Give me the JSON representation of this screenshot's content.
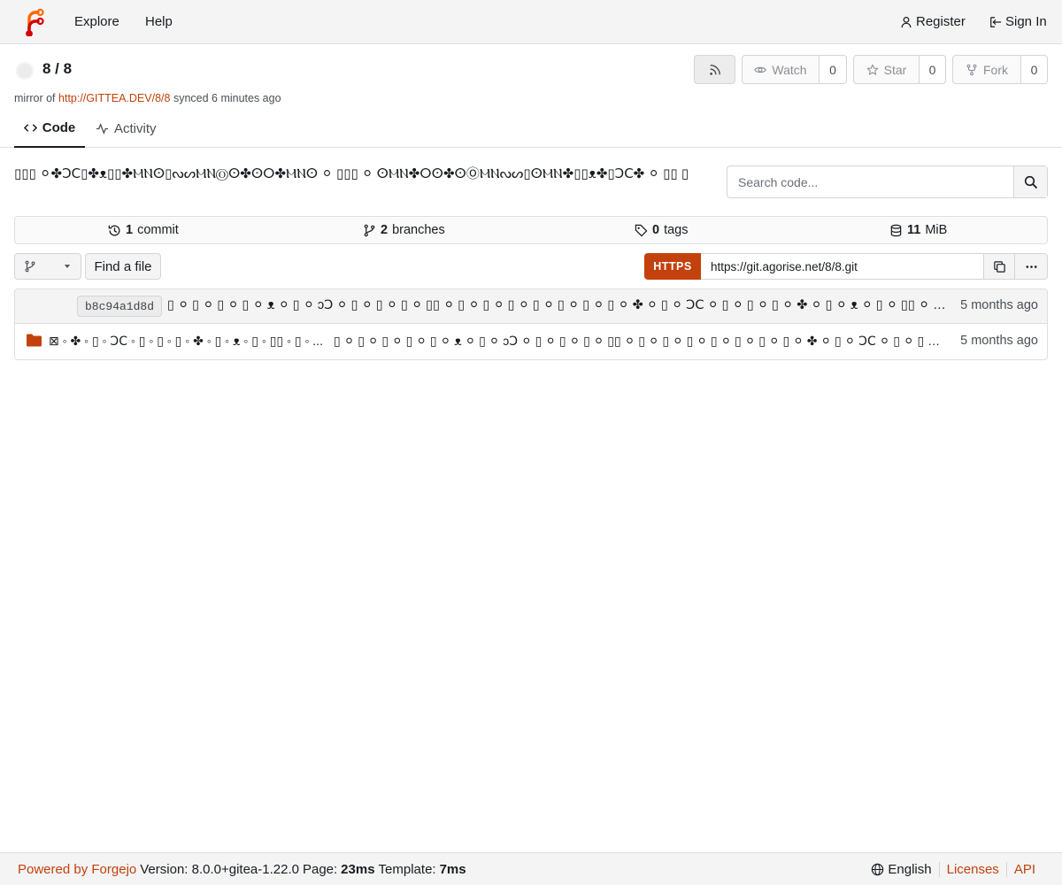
{
  "nav": {
    "explore": "Explore",
    "help": "Help",
    "register": "Register",
    "signin": "Sign In"
  },
  "repo": {
    "title": "8 / 8",
    "mirror_prefix": "mirror of",
    "mirror_url": "http://GITTEA.DEV/8/8",
    "mirror_suffix": "synced 6 minutes ago",
    "description": "▯▯▯ ⚪✤ↃⅭ▯✤ᴥ▯▯✤ⲘⲚⵙ▯ᔓᔕⲘⲚⓄⵙ✤ⵙⵔ✤ⲘⲚⵙ ⚪ ▯▯▯ ⚪ ⵙⲘⲚ✤ⵔⵙ✤ⵙⓄⲘⲚᔓᔕ▯ⵙⲘⲚ✤▯▯ᴥ✤▯ↃⅭ✤ ⚪ ▯▯ ▯"
  },
  "actions": {
    "watch_label": "Watch",
    "watch_count": "0",
    "star_label": "Star",
    "star_count": "0",
    "fork_label": "Fork",
    "fork_count": "0"
  },
  "tabs": {
    "code": "Code",
    "activity": "Activity"
  },
  "search": {
    "placeholder": "Search code..."
  },
  "stats": {
    "commits_num": "1",
    "commits_label": "commit",
    "branches_num": "2",
    "branches_label": "branches",
    "tags_num": "0",
    "tags_label": "tags",
    "size_num": "11",
    "size_unit": "MiB"
  },
  "toolbar": {
    "find_file": "Find a file",
    "clone_protocol": "HTTPS",
    "clone_url": "https://git.agorise.net/8/8.git"
  },
  "files": {
    "latest_commit": {
      "sha": "b8c94a1d8d",
      "message": "▯ ⚪ ▯ ⚪ ▯ ⚪ ▯ ⚪ ᴥ ⚪ ▯ ⚪ ↄↃ ⚪ ▯ ⚪ ▯ ⚪ ▯ ⚪ ▯▯ ⚪ ▯ ⚪ ▯ ⚪ ▯ ⚪ ▯ ⚪ ▯ ⚪ ▯ ⚪ ▯ ⚪ ✤ ⚪ ▯ ⚪ ↃⅭ ⚪ ▯ ⚪ ▯ ⚪ ▯ ⚪ ✤ ⚪ ▯ ⚪ ᴥ ⚪ ▯ ⚪ ▯▯ ⚪ ▯ ⚪ ✤ ⚪ ▯ ⚪ ⲘⲚ ⚪ ▯ ⚪ ...",
      "time": "5 months ago"
    },
    "entries": [
      {
        "icon": "folder-icon",
        "name": "⊠ ◦ ✤ ◦ ▯ ◦ ↃⅭ ◦ ▯ ◦ ▯ ◦ ▯ ◦ ✤ ◦ ▯ ◦ ᴥ ◦ ▯ ◦ ▯▯ ◦ ▯ ◦ ...",
        "commit": "▯ ⚪ ▯ ⚪ ▯ ⚪ ▯ ⚪ ▯ ⚪ ᴥ ⚪ ▯ ⚪ ↄↃ ⚪ ▯ ⚪ ▯ ⚪ ▯ ⚪ ▯▯ ⚪ ▯ ⚪ ▯ ⚪ ▯ ⚪ ▯ ⚪ ▯ ⚪ ▯ ⚪ ▯ ⚪ ✤ ⚪ ▯ ⚪ ↃⅭ ⚪ ▯ ⚪ ▯ ⚪ ▯ ⚪ ✤ ⚪ ▯ ⚪ ᴥ ...",
        "time": "5 months ago"
      }
    ]
  },
  "footer": {
    "powered_by": "Powered by Forgejo",
    "version": "Version: 8.0.0+gitea-1.22.0",
    "page_label": "Page:",
    "page_time": "23ms",
    "template_label": "Template:",
    "template_time": "7ms",
    "language": "English",
    "licenses": "Licenses",
    "api": "API"
  },
  "colors": {
    "accent": "#c2410c",
    "logo_orange": "#ff6600",
    "logo_red": "#d40000"
  }
}
